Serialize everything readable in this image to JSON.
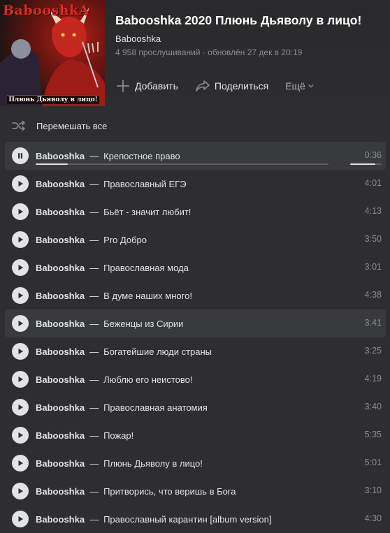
{
  "album": {
    "cover": {
      "logo_text": "BabooshkA",
      "caption": "Плюнь Дьяволу в лицо!"
    },
    "title": "Babooshka 2020 Плюнь Дьяволу в лицо!",
    "artist": "Babooshka",
    "meta": "4 958 прослушиваний · обновлён 27 дек в 20:19"
  },
  "actions": {
    "add_label": "Добавить",
    "share_label": "Поделиться",
    "more_label": "Ещё"
  },
  "shuffle_label": "Перемешать все",
  "player": {
    "progress_fraction": 0.11,
    "volume_fraction": 0.8
  },
  "tracks": [
    {
      "artist": "Babooshka",
      "title": "Крепостное право",
      "duration": "0:36",
      "state": "playing"
    },
    {
      "artist": "Babooshka",
      "title": "Православный ЕГЭ",
      "duration": "4:01"
    },
    {
      "artist": "Babooshka",
      "title": "Бьёт - значит любит!",
      "duration": "4:13"
    },
    {
      "artist": "Babooshka",
      "title": "Pro Добро",
      "duration": "3:50"
    },
    {
      "artist": "Babooshka",
      "title": "Православная мода",
      "duration": "3:01"
    },
    {
      "artist": "Babooshka",
      "title": "В думе наших много!",
      "duration": "4:38"
    },
    {
      "artist": "Babooshka",
      "title": "Беженцы из Сирии",
      "duration": "3:41",
      "state": "hover"
    },
    {
      "artist": "Babooshka",
      "title": "Богатейшие люди страны",
      "duration": "3:25"
    },
    {
      "artist": "Babooshka",
      "title": "Люблю его неистово!",
      "duration": "4:19"
    },
    {
      "artist": "Babooshka",
      "title": "Православная анатомия",
      "duration": "3:40"
    },
    {
      "artist": "Babooshka",
      "title": "Пожар!",
      "duration": "5:35"
    },
    {
      "artist": "Babooshka",
      "title": "Плюнь Дьяволу в лицо!",
      "duration": "5:01"
    },
    {
      "artist": "Babooshka",
      "title": "Притворись, что веришь в Бога",
      "duration": "3:10"
    },
    {
      "artist": "Babooshka",
      "title": "Православный карантин [album version]",
      "duration": "4:30"
    }
  ],
  "colors": {
    "background": "#2e2e30",
    "row_highlight": "#393a3c",
    "text_primary": "#e1e3e6",
    "text_secondary": "#8b8c8f"
  }
}
